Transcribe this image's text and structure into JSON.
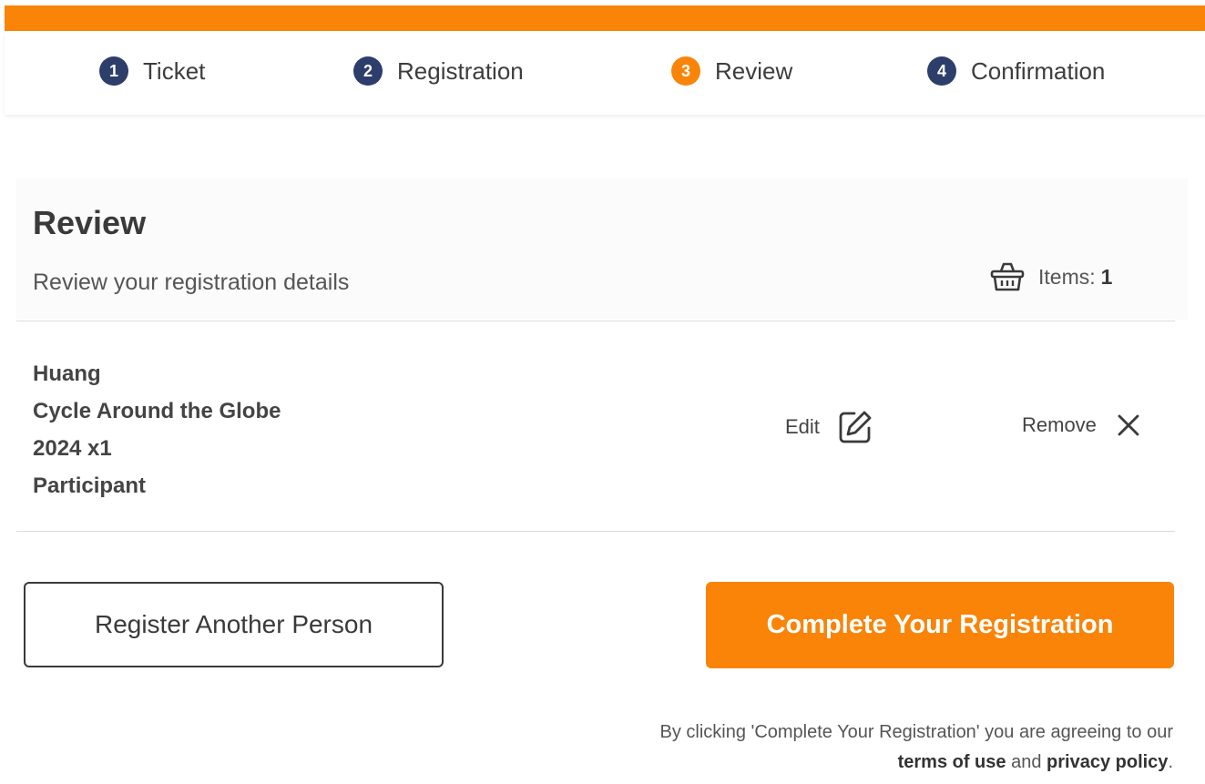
{
  "steps": [
    {
      "num": "1",
      "label": "Ticket"
    },
    {
      "num": "2",
      "label": "Registration"
    },
    {
      "num": "3",
      "label": "Review"
    },
    {
      "num": "4",
      "label": "Confirmation"
    }
  ],
  "review": {
    "title": "Review",
    "subtitle": "Review your registration details",
    "items_label": "Items:",
    "items_count": "1"
  },
  "entry": {
    "name": "Huang",
    "event": "Cycle Around the Globe",
    "detail": "2024 x1",
    "role": "Participant",
    "edit_label": "Edit",
    "remove_label": "Remove"
  },
  "actions": {
    "register_another": "Register Another Person",
    "complete": "Complete Your Registration"
  },
  "disclaimer": {
    "line1": "By clicking 'Complete Your Registration' you are agreeing to our",
    "terms": "terms of use",
    "and": "and",
    "privacy": "privacy policy",
    "period": "."
  },
  "colors": {
    "accent": "#f98407",
    "step_inactive": "#2d3e6b"
  }
}
